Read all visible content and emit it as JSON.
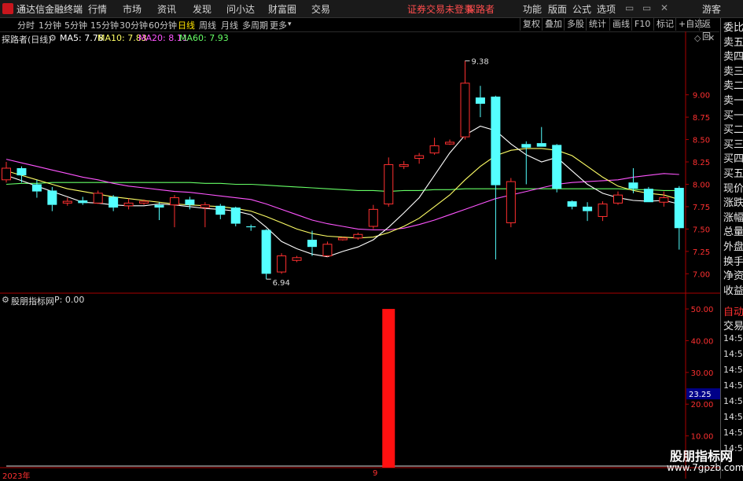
{
  "titlebar": {
    "app_title": "通达信金融终端",
    "menu": [
      "行情",
      "市场",
      "资讯",
      "发现",
      "问小达",
      "财富圈",
      "交易"
    ],
    "login_status": "证券交易未登录",
    "user": "探路者",
    "right_menu": [
      "功能",
      "版面",
      "公式",
      "选项"
    ],
    "guest": "游客"
  },
  "toolbar": {
    "periods": [
      "分时",
      "1分钟",
      "5分钟",
      "15分钟",
      "30分钟",
      "60分钟",
      "日线",
      "周线",
      "月线",
      "多周期",
      "更多"
    ],
    "active_period": "日线",
    "buttons": [
      "复权",
      "叠加",
      "多股",
      "统计",
      "画线",
      "F10",
      "标记",
      "+自选",
      "返回"
    ]
  },
  "main_chart": {
    "stock_label": "探路者(日线)",
    "ma": [
      {
        "label": "MA5: 7.78",
        "color": "#ffffff"
      },
      {
        "label": "MA10: 7.83",
        "color": "#ffff66"
      },
      {
        "label": "MA20: 8.11",
        "color": "#ff55ff"
      },
      {
        "label": "MA60: 7.93",
        "color": "#66ff66"
      }
    ],
    "price_axis": [
      "9.00",
      "8.75",
      "8.50",
      "8.25",
      "8.00",
      "7.75",
      "7.50",
      "7.25",
      "7.00"
    ],
    "high_annotation": "9.38",
    "low_annotation": "6.94"
  },
  "indicator_panel": {
    "name": "股朋指标网",
    "value_label": "P: 0.00",
    "axis": [
      "50.00",
      "40.00",
      "30.00",
      "20.00",
      "10.00"
    ],
    "current_tag": "23.25"
  },
  "side_panel": {
    "labels": [
      "委比",
      "卖五",
      "卖四",
      "卖三",
      "卖二",
      "卖一",
      "买一",
      "买二",
      "买三",
      "买四",
      "买五",
      "现价",
      "涨跌",
      "涨幅",
      "总量",
      "外盘",
      "换手",
      "净资",
      "收益"
    ],
    "auto_label": "自动",
    "trade_label": "交易",
    "times": [
      "14:56",
      "14:56",
      "14:56",
      "14:56",
      "14:56",
      "14:56",
      "14:56",
      "14:56"
    ]
  },
  "dates": {
    "left": "2023年",
    "mid": "9"
  },
  "watermark": {
    "name": "股朋指标网",
    "url": "www.7gpzb.com"
  },
  "colors": {
    "up": "#ff3030",
    "down": "#54ffff",
    "ma5": "#ffffff",
    "ma10": "#ffff66",
    "ma20": "#ff55ff",
    "ma60": "#66ff66",
    "grid_red": "#aa0000"
  },
  "chart_data": [
    {
      "type": "candlestick",
      "title": "探路者(日线)",
      "ylim": [
        6.88,
        9.55
      ],
      "candles": [
        {
          "o": 8.05,
          "h": 8.25,
          "l": 8.02,
          "c": 8.18
        },
        {
          "o": 8.18,
          "h": 8.2,
          "l": 8.02,
          "c": 8.1
        },
        {
          "o": 8.0,
          "h": 8.05,
          "l": 7.85,
          "c": 7.92
        },
        {
          "o": 7.93,
          "h": 7.97,
          "l": 7.7,
          "c": 7.77
        },
        {
          "o": 7.79,
          "h": 7.85,
          "l": 7.76,
          "c": 7.81
        },
        {
          "o": 7.82,
          "h": 7.86,
          "l": 7.77,
          "c": 7.79
        },
        {
          "o": 7.79,
          "h": 7.93,
          "l": 7.78,
          "c": 7.9
        },
        {
          "o": 7.86,
          "h": 7.88,
          "l": 7.7,
          "c": 7.74
        },
        {
          "o": 7.76,
          "h": 7.84,
          "l": 7.72,
          "c": 7.79
        },
        {
          "o": 7.79,
          "h": 7.83,
          "l": 7.77,
          "c": 7.81
        },
        {
          "o": 7.77,
          "h": 7.8,
          "l": 7.6,
          "c": 7.74
        },
        {
          "o": 7.77,
          "h": 7.88,
          "l": 7.52,
          "c": 7.85
        },
        {
          "o": 7.83,
          "h": 7.86,
          "l": 7.72,
          "c": 7.77
        },
        {
          "o": 7.74,
          "h": 7.8,
          "l": 7.52,
          "c": 7.77
        },
        {
          "o": 7.76,
          "h": 7.78,
          "l": 7.61,
          "c": 7.66
        },
        {
          "o": 7.74,
          "h": 7.75,
          "l": 7.53,
          "c": 7.56
        },
        {
          "o": 7.53,
          "h": 7.55,
          "l": 7.48,
          "c": 7.52
        },
        {
          "o": 7.49,
          "h": 7.5,
          "l": 6.94,
          "c": 7.0
        },
        {
          "o": 7.02,
          "h": 7.23,
          "l": 7.0,
          "c": 7.2
        },
        {
          "o": 7.15,
          "h": 7.2,
          "l": 7.13,
          "c": 7.18
        },
        {
          "o": 7.38,
          "h": 7.48,
          "l": 7.2,
          "c": 7.3
        },
        {
          "o": 7.2,
          "h": 7.36,
          "l": 7.19,
          "c": 7.33
        },
        {
          "o": 7.38,
          "h": 7.41,
          "l": 7.37,
          "c": 7.4
        },
        {
          "o": 7.4,
          "h": 7.46,
          "l": 7.38,
          "c": 7.44
        },
        {
          "o": 7.53,
          "h": 7.77,
          "l": 7.5,
          "c": 7.72
        },
        {
          "o": 7.78,
          "h": 8.3,
          "l": 7.75,
          "c": 8.22
        },
        {
          "o": 8.2,
          "h": 8.26,
          "l": 8.17,
          "c": 8.22
        },
        {
          "o": 8.29,
          "h": 8.35,
          "l": 8.23,
          "c": 8.32
        },
        {
          "o": 8.35,
          "h": 8.52,
          "l": 8.33,
          "c": 8.43
        },
        {
          "o": 8.45,
          "h": 8.5,
          "l": 8.44,
          "c": 8.47
        },
        {
          "o": 8.53,
          "h": 9.38,
          "l": 8.5,
          "c": 9.13
        },
        {
          "o": 8.97,
          "h": 9.1,
          "l": 8.75,
          "c": 8.9
        },
        {
          "o": 8.98,
          "h": 8.99,
          "l": 7.16,
          "c": 7.99
        },
        {
          "o": 7.57,
          "h": 8.07,
          "l": 7.52,
          "c": 8.03
        },
        {
          "o": 8.45,
          "h": 8.48,
          "l": 8.0,
          "c": 8.41
        },
        {
          "o": 8.46,
          "h": 8.64,
          "l": 8.42,
          "c": 8.42
        },
        {
          "o": 8.44,
          "h": 8.45,
          "l": 7.91,
          "c": 7.95
        },
        {
          "o": 7.81,
          "h": 7.82,
          "l": 7.72,
          "c": 7.75
        },
        {
          "o": 7.75,
          "h": 7.8,
          "l": 7.59,
          "c": 7.7
        },
        {
          "o": 7.64,
          "h": 7.81,
          "l": 7.59,
          "c": 7.78
        },
        {
          "o": 7.79,
          "h": 7.92,
          "l": 7.77,
          "c": 7.88
        },
        {
          "o": 8.02,
          "h": 8.18,
          "l": 7.9,
          "c": 7.95
        },
        {
          "o": 7.95,
          "h": 7.97,
          "l": 7.8,
          "c": 7.8
        },
        {
          "o": 7.8,
          "h": 7.92,
          "l": 7.75,
          "c": 7.85
        },
        {
          "o": 7.96,
          "h": 7.98,
          "l": 7.27,
          "c": 7.51
        }
      ],
      "ma5": [
        8.1,
        8.04,
        7.98,
        7.92,
        7.86,
        7.8,
        7.79,
        7.77,
        7.76,
        7.76,
        7.78,
        7.77,
        7.75,
        7.73,
        7.72,
        7.7,
        7.66,
        7.52,
        7.36,
        7.28,
        7.22,
        7.19,
        7.25,
        7.3,
        7.38,
        7.52,
        7.68,
        7.85,
        8.1,
        8.35,
        8.55,
        8.65,
        8.6,
        8.45,
        8.33,
        8.25,
        8.3,
        8.15,
        8.0,
        7.9,
        7.85,
        7.82,
        7.81,
        7.82,
        7.78
      ],
      "ma10": [
        8.15,
        8.1,
        8.05,
        8.0,
        7.95,
        7.92,
        7.89,
        7.86,
        7.84,
        7.82,
        7.8,
        7.78,
        7.77,
        7.76,
        7.75,
        7.73,
        7.7,
        7.64,
        7.57,
        7.5,
        7.45,
        7.42,
        7.41,
        7.4,
        7.41,
        7.46,
        7.53,
        7.62,
        7.75,
        7.88,
        8.05,
        8.2,
        8.32,
        8.38,
        8.4,
        8.4,
        8.38,
        8.32,
        8.2,
        8.08,
        7.98,
        7.93,
        7.9,
        7.88,
        7.83
      ],
      "ma20": [
        8.28,
        8.24,
        8.2,
        8.16,
        8.12,
        8.08,
        8.05,
        8.01,
        7.98,
        7.96,
        7.94,
        7.92,
        7.91,
        7.89,
        7.87,
        7.85,
        7.83,
        7.78,
        7.72,
        7.66,
        7.6,
        7.56,
        7.53,
        7.5,
        7.49,
        7.49,
        7.51,
        7.55,
        7.6,
        7.66,
        7.72,
        7.78,
        7.84,
        7.88,
        7.92,
        7.96,
        8.0,
        8.02,
        8.03,
        8.04,
        8.05,
        8.08,
        8.1,
        8.12,
        8.11
      ],
      "ma60": [
        8.0,
        8.01,
        8.01,
        8.02,
        8.02,
        8.02,
        8.02,
        8.02,
        8.02,
        8.02,
        8.02,
        8.02,
        8.02,
        8.01,
        8.01,
        8.0,
        8.0,
        7.99,
        7.98,
        7.97,
        7.96,
        7.95,
        7.94,
        7.93,
        7.93,
        7.92,
        7.93,
        7.93,
        7.94,
        7.94,
        7.95,
        7.95,
        7.95,
        7.95,
        7.95,
        7.95,
        7.95,
        7.95,
        7.95,
        7.95,
        7.95,
        7.94,
        7.94,
        7.93,
        7.93
      ]
    },
    {
      "type": "bar",
      "title": "股朋指标网",
      "ylim": [
        0,
        52
      ],
      "values": [
        0,
        0,
        0,
        0,
        0,
        0,
        0,
        0,
        0,
        0,
        0,
        0,
        0,
        0,
        0,
        0,
        0,
        0,
        0,
        0,
        0,
        0,
        0,
        0,
        0,
        50,
        0,
        0,
        0,
        0,
        0,
        0,
        0,
        0,
        0,
        0,
        0,
        0,
        0,
        0,
        0,
        0,
        0,
        0,
        0
      ]
    }
  ]
}
